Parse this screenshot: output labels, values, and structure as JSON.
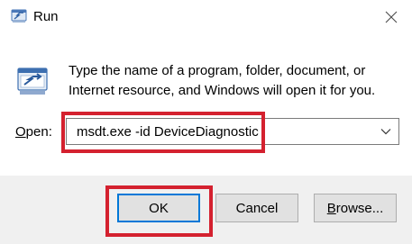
{
  "window": {
    "title": "Run",
    "close_icon": "close-icon",
    "app_icon": "run-app-icon"
  },
  "main": {
    "run_icon": "run-icon",
    "description": "Type the name of a program, folder, document, or Internet resource, and Windows will open it for you.",
    "open_label_prefix": "O",
    "open_label_rest": "pen:",
    "open_value": "msdt.exe -id DeviceDiagnostic",
    "dropdown_icon": "chevron-down-icon"
  },
  "footer": {
    "ok_label": "OK",
    "cancel_label": "Cancel",
    "browse_prefix": "B",
    "browse_rest": "rowse..."
  },
  "colors": {
    "highlight": "#d4212f",
    "default_button_border": "#0078d7",
    "button_face": "#e1e1e1",
    "footer_background": "#f0f0f0"
  }
}
